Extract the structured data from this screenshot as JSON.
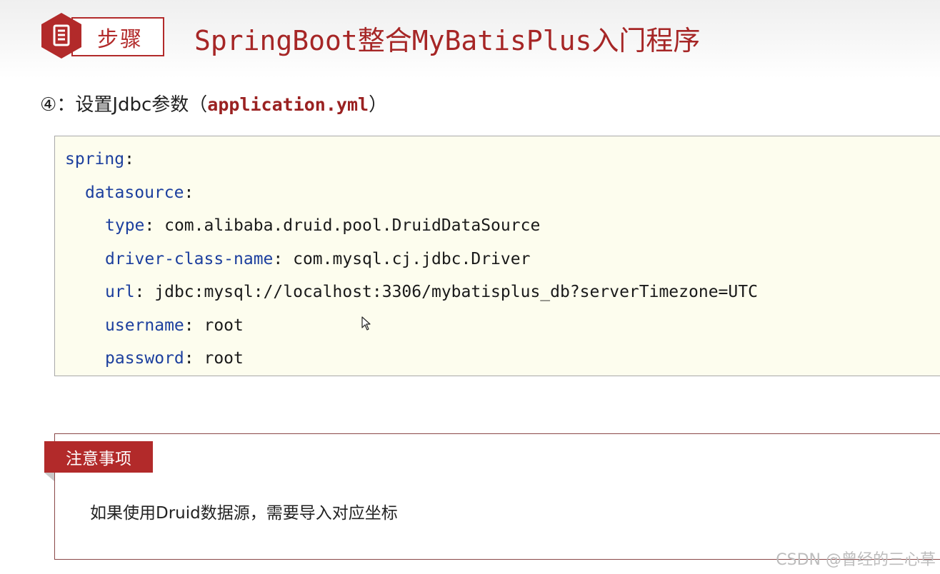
{
  "header": {
    "icon": "document-icon",
    "step_label": "步骤",
    "title": "SpringBoot整合MyBatisPlus入门程序"
  },
  "step": {
    "number": "④",
    "prefix": "：设置Jdbc参数（",
    "filename": "application.yml",
    "suffix": "）"
  },
  "code": {
    "lines": [
      {
        "key": "spring",
        "sep": ":",
        "value": ""
      },
      {
        "key": "datasource",
        "sep": ":",
        "value": ""
      },
      {
        "key": "type",
        "sep": ": ",
        "value": "com.alibaba.druid.pool.DruidDataSource"
      },
      {
        "key": "driver-class-name",
        "sep": ": ",
        "value": "com.mysql.cj.jdbc.Driver"
      },
      {
        "key": "url",
        "sep": ": ",
        "value": "jdbc:mysql://localhost:3306/mybatisplus_db?serverTimezone=UTC"
      },
      {
        "key": "username",
        "sep": ": ",
        "value": "root"
      },
      {
        "key": "password",
        "sep": ": ",
        "value": "root"
      }
    ]
  },
  "notice": {
    "tag": "注意事项",
    "text": "如果使用Druid数据源，需要导入对应坐标"
  },
  "watermark": "CSDN @曾经的三心草",
  "colors": {
    "accent_red": "#b22a2a",
    "title_red": "#a62626",
    "code_key_blue": "#1c3f9e",
    "code_bg": "#fdfdee"
  }
}
